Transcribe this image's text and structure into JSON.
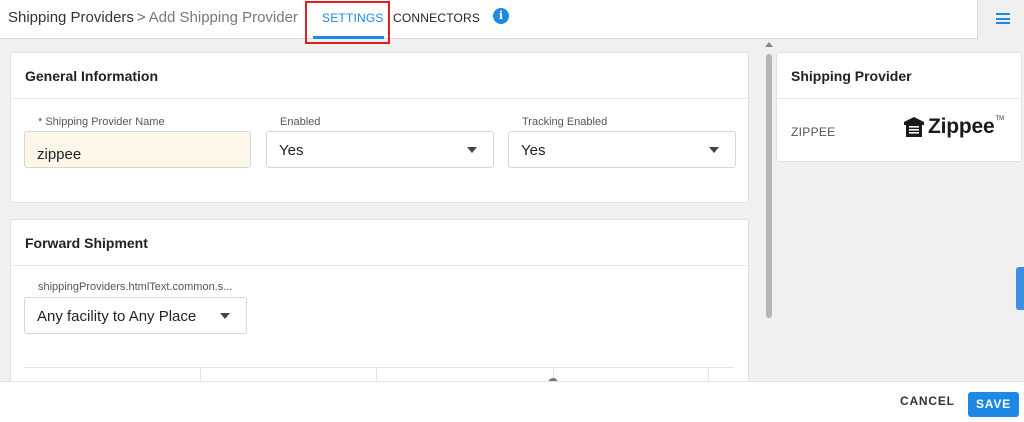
{
  "header": {
    "breadcrumb_root": "Shipping Providers",
    "breadcrumb_separator": ">",
    "breadcrumb_current": "Add Shipping Provider",
    "tabs": [
      {
        "label": "SETTINGS",
        "active": true
      },
      {
        "label": "CONNECTORS",
        "active": false
      }
    ],
    "info_icon": "info-icon",
    "menu_icon": "hamburger-menu-icon",
    "highlight_color": "#e02020"
  },
  "general_info": {
    "title": "General Information",
    "fields": [
      {
        "label": "* Shipping Provider Name",
        "value": "zippee",
        "type": "text"
      },
      {
        "label": "Enabled",
        "value": "Yes",
        "type": "select"
      },
      {
        "label": "Tracking Enabled",
        "value": "Yes",
        "type": "select"
      }
    ]
  },
  "forward_shipment": {
    "title": "Forward Shipment",
    "field_label": "shippingProviders.htmlText.common.s...",
    "field_value": "Any facility to Any Place"
  },
  "provider_panel": {
    "title": "Shipping Provider",
    "name": "ZIPPEE",
    "logo_text": "Zippee",
    "logo_tm": "TM"
  },
  "footer": {
    "cancel_label": "CANCEL",
    "save_label": "SAVE"
  },
  "colors": {
    "accent": "#1e88e5",
    "input_bg": "#fdf7ea"
  }
}
